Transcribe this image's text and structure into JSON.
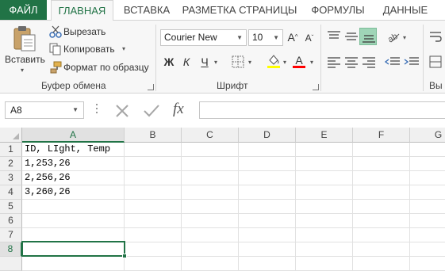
{
  "tabs": [
    "ФАЙЛ",
    "ГЛАВНАЯ",
    "ВСТАВКА",
    "РАЗМЕТКА СТРАНИЦЫ",
    "ФОРМУЛЫ",
    "ДАННЫЕ"
  ],
  "clipboard": {
    "paste": "Вставить",
    "cut": "Вырезать",
    "copy": "Копировать",
    "format_painter": "Формат по образцу",
    "group": "Буфер обмена"
  },
  "font": {
    "name": "Courier New",
    "size": "10",
    "bold": "Ж",
    "italic": "К",
    "underline": "Ч",
    "grow": "A",
    "shrink": "A",
    "color_letter": "A",
    "group": "Шрифт",
    "fill_color": "#ffff00",
    "font_color": "#ff0000"
  },
  "alignment": {
    "group_partial": "Вы"
  },
  "formula_bar": {
    "name_box": "A8",
    "fx": "fx",
    "formula": ""
  },
  "grid": {
    "columns": [
      "A",
      "B",
      "C",
      "D",
      "E",
      "F",
      "G"
    ],
    "rows": [
      "1",
      "2",
      "3",
      "4",
      "5",
      "6",
      "7",
      "8"
    ],
    "cells_a": [
      "ID, LIght, Temp",
      "1,253,26",
      "2,256,26",
      "3,260,26",
      "",
      "",
      "",
      ""
    ],
    "selected_cell": "A8"
  },
  "colors": {
    "accent": "#217346"
  }
}
